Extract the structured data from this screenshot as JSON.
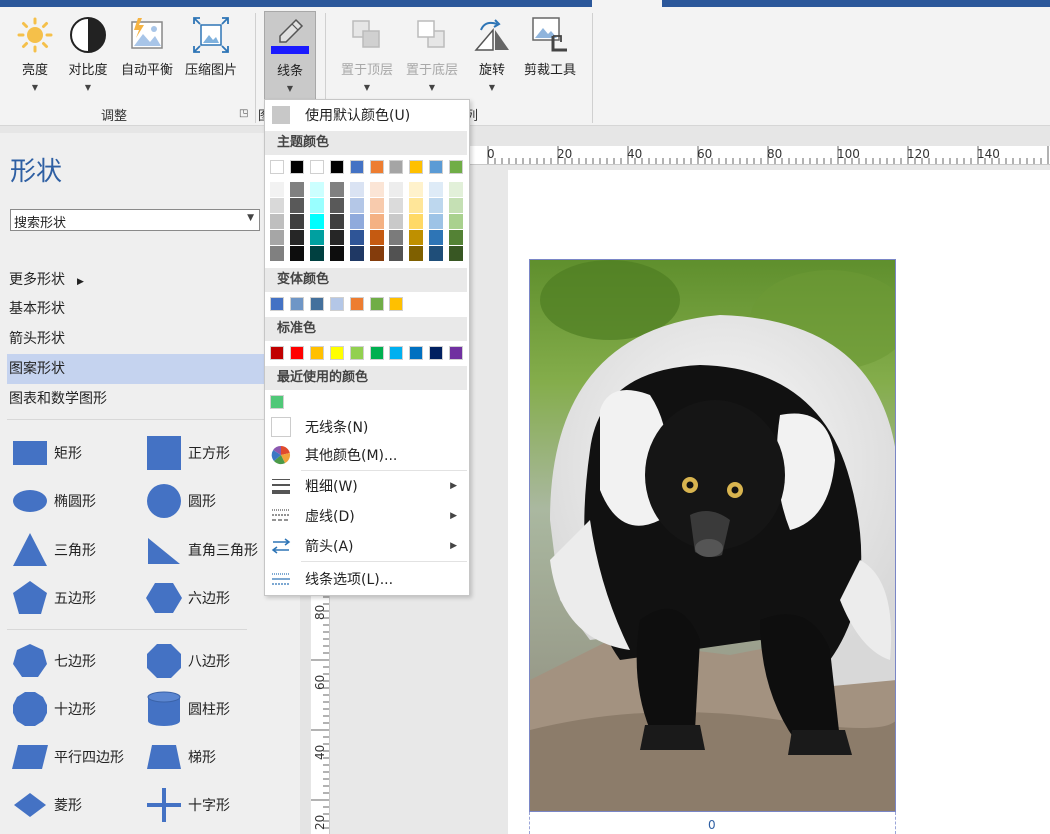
{
  "ribbon": {
    "buttons": {
      "brightness": "亮度",
      "contrast": "对比度",
      "auto_balance": "自动平衡",
      "compress": "压缩图片",
      "line": "线条",
      "bring_front": "置于顶层",
      "send_back": "置于底层",
      "rotate": "旋转",
      "crop": "剪裁工具"
    },
    "group_adjust": "调整",
    "group_arrange_partial": "图",
    "group_arrange_tail": "列",
    "line_accent": "#1a1aff"
  },
  "shapes_panel": {
    "title": "形状",
    "search_placeholder": "搜索形状",
    "categories": [
      "更多形状",
      "基本形状",
      "箭头形状",
      "图案形状",
      "图表和数学图形"
    ],
    "selected_category": "图案形状",
    "shapes": [
      {
        "name": "矩形",
        "icon": "rectangle-icon"
      },
      {
        "name": "正方形",
        "icon": "square-icon"
      },
      {
        "name": "椭圆形",
        "icon": "ellipse-icon"
      },
      {
        "name": "圆形",
        "icon": "circle-icon"
      },
      {
        "name": "三角形",
        "icon": "triangle-icon"
      },
      {
        "name": "直角三角形",
        "icon": "right-triangle-icon"
      },
      {
        "name": "五边形",
        "icon": "pentagon-icon"
      },
      {
        "name": "六边形",
        "icon": "hexagon-icon"
      },
      {
        "name": "七边形",
        "icon": "heptagon-icon"
      },
      {
        "name": "八边形",
        "icon": "octagon-icon"
      },
      {
        "name": "十边形",
        "icon": "decagon-icon"
      },
      {
        "name": "圆柱形",
        "icon": "cylinder-icon"
      },
      {
        "name": "平行四边形",
        "icon": "parallelogram-icon"
      },
      {
        "name": "梯形",
        "icon": "trapezoid-icon"
      },
      {
        "name": "菱形",
        "icon": "diamond-icon"
      },
      {
        "name": "十字形",
        "icon": "cross-icon"
      }
    ],
    "shape_color": "#4472c4"
  },
  "line_menu": {
    "default_color": "使用默认颜色(U)",
    "theme_colors_label": "主题颜色",
    "theme_colors": [
      "#ffffff",
      "#000000",
      "#ffffff",
      "#000000",
      "#4472c4",
      "#ed7d31",
      "#a5a5a5",
      "#ffc000",
      "#5b9bd5",
      "#70ad47"
    ],
    "theme_shades": [
      [
        "#f2f2f2",
        "#d9d9d9",
        "#bfbfbf",
        "#a6a6a6",
        "#808080"
      ],
      [
        "#808080",
        "#595959",
        "#404040",
        "#262626",
        "#0d0d0d"
      ],
      [
        "#ccffff",
        "#99ffff",
        "#00ffff",
        "#00a0a0",
        "#004040"
      ],
      [
        "#808080",
        "#595959",
        "#404040",
        "#262626",
        "#0d0d0d"
      ],
      [
        "#dae3f3",
        "#b4c7e7",
        "#8faadc",
        "#2f5597",
        "#1f3864"
      ],
      [
        "#fbe5d6",
        "#f8cbad",
        "#f4b183",
        "#c55a11",
        "#843c0c"
      ],
      [
        "#ededed",
        "#dbdbdb",
        "#c9c9c9",
        "#7b7b7b",
        "#525252"
      ],
      [
        "#fff2cc",
        "#ffe699",
        "#ffd966",
        "#bf9000",
        "#7f6000"
      ],
      [
        "#deebf7",
        "#bdd7ee",
        "#9dc3e6",
        "#2e75b6",
        "#1f4e79"
      ],
      [
        "#e2f0d9",
        "#c5e0b4",
        "#a9d18e",
        "#548235",
        "#385723"
      ]
    ],
    "variant_colors_label": "变体颜色",
    "variant_colors": [
      "#4472c4",
      "#6f96c6",
      "#44709c",
      "#b4c7e7",
      "#ed7d31",
      "#70ad47",
      "#ffc000"
    ],
    "standard_colors_label": "标准色",
    "standard_colors": [
      "#c00000",
      "#ff0000",
      "#ffc000",
      "#ffff00",
      "#92d050",
      "#00b050",
      "#00b0f0",
      "#0070c0",
      "#002060",
      "#7030a0"
    ],
    "recent_colors_label": "最近使用的颜色",
    "recent_colors": [
      "#50c878"
    ],
    "no_line": "无线条(N)",
    "more_colors": "其他颜色(M)...",
    "weight": "粗细(W)",
    "dash": "虚线(D)",
    "arrows": "箭头(A)",
    "line_options": "线条选项(L)..."
  },
  "rulers": {
    "horizontal": [
      "0",
      "20",
      "40",
      "60",
      "80",
      "100",
      "120",
      "140"
    ],
    "vertical": [
      "80",
      "60",
      "40",
      "20"
    ]
  },
  "canvas": {
    "shape_label": "0"
  }
}
